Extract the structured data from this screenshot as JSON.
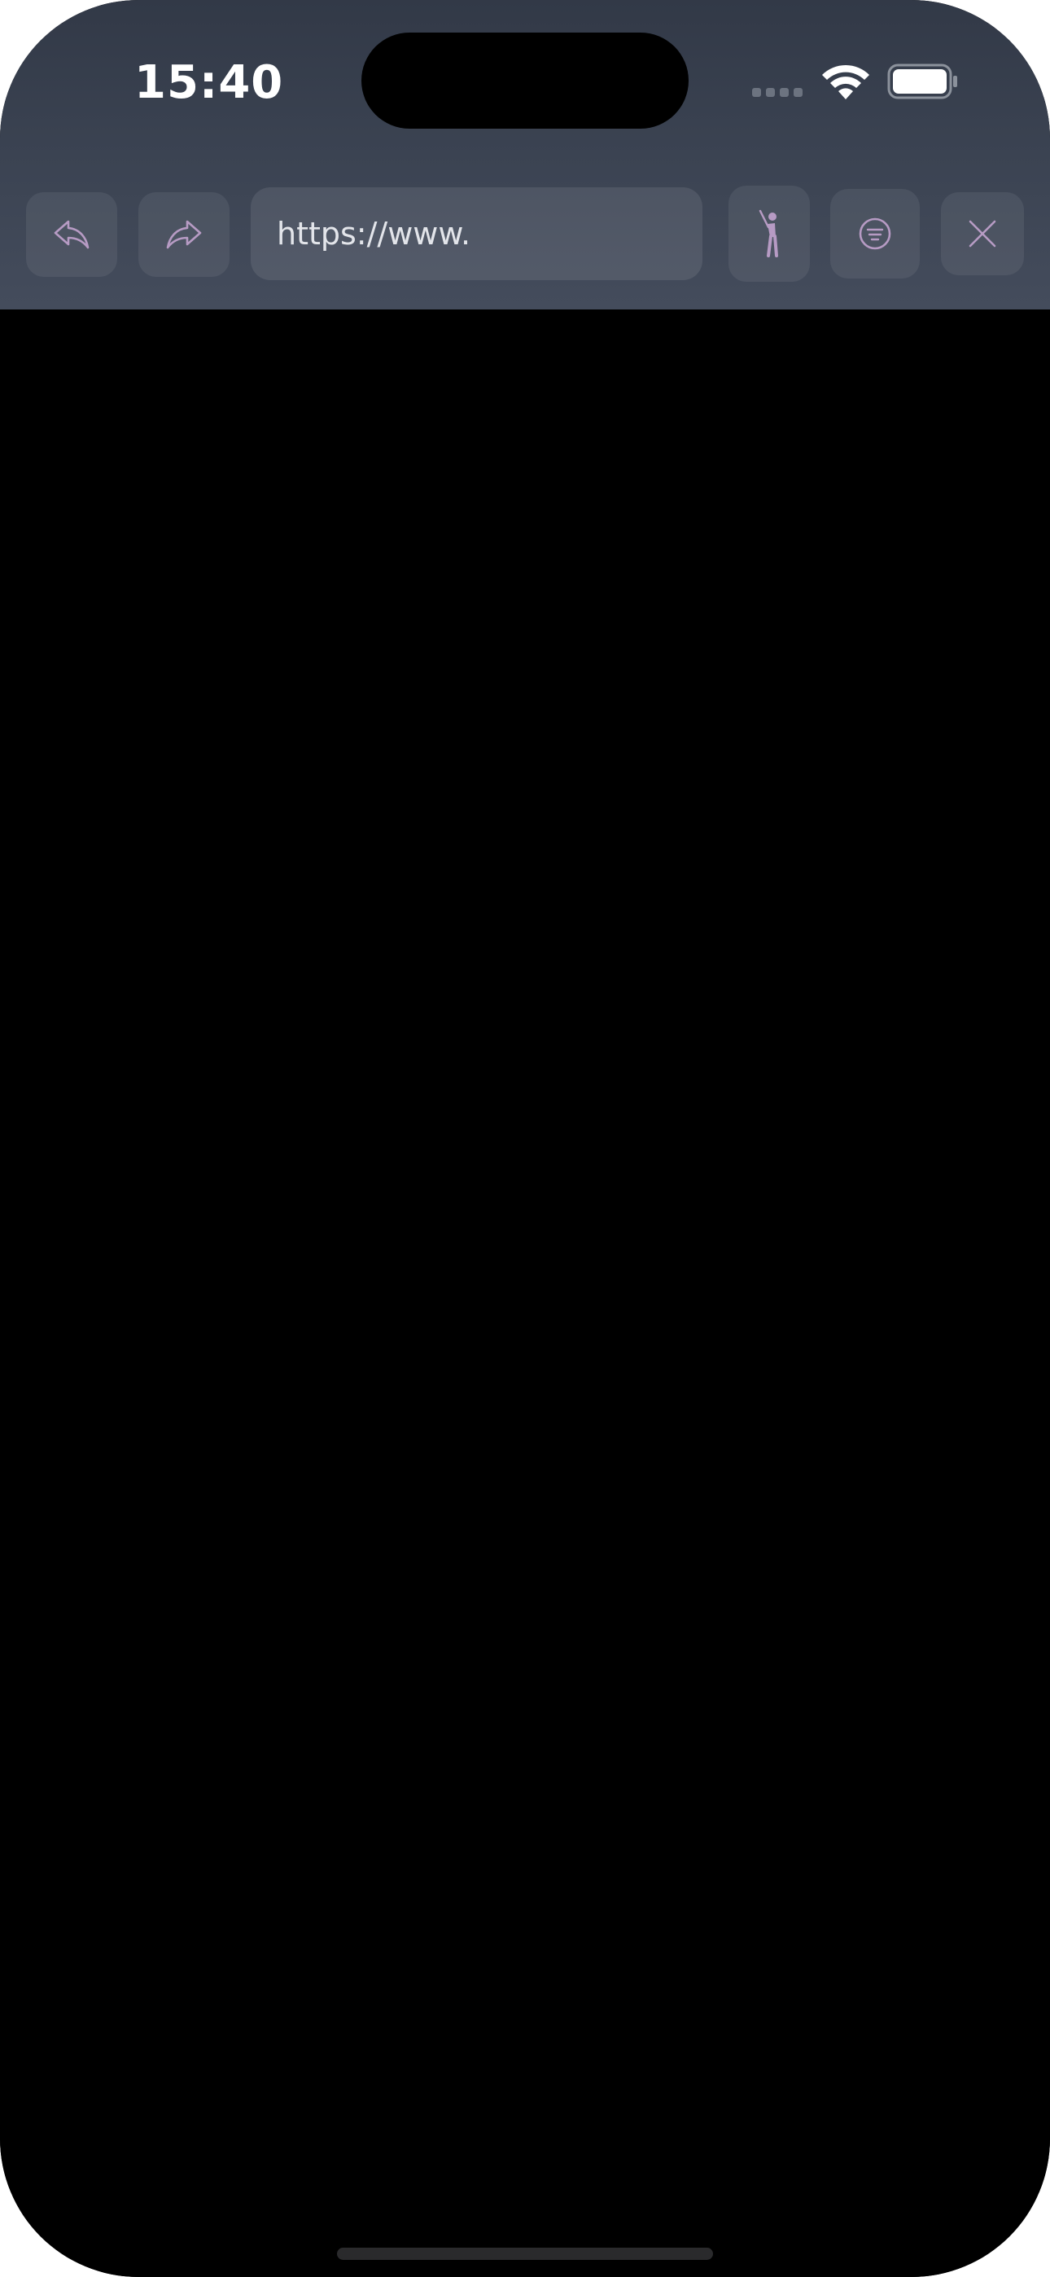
{
  "status_bar": {
    "time": "15:40"
  },
  "toolbar": {
    "url": "https://www.",
    "icons": {
      "back": "reply-arrow-icon",
      "forward": "forward-arrow-icon",
      "activity": "golfer-figure-icon",
      "menu": "circle-lines-icon",
      "close": "close-icon"
    }
  },
  "colors": {
    "toolbar_bg": "#3b4352",
    "icon_accent": "#b79bc4",
    "page_bg": "#000000",
    "url_text": "#e3e5ea"
  }
}
